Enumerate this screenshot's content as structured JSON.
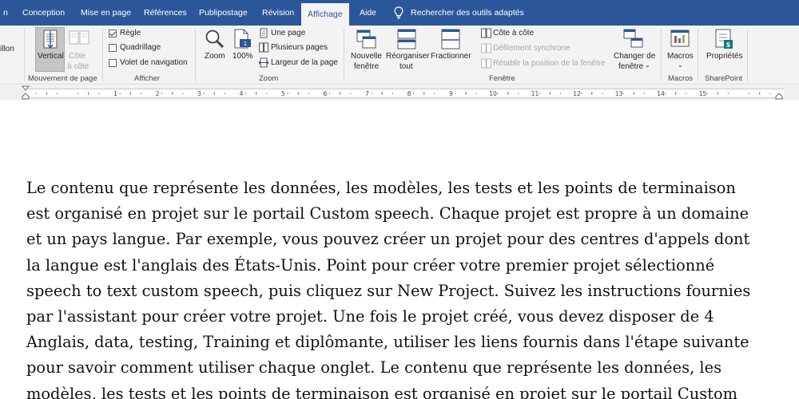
{
  "tabs": [
    {
      "label": "n",
      "active": false
    },
    {
      "label": "Conception",
      "active": false
    },
    {
      "label": "Mise en page",
      "active": false
    },
    {
      "label": "Références",
      "active": false
    },
    {
      "label": "Publipostage",
      "active": false
    },
    {
      "label": "Révision",
      "active": false
    },
    {
      "label": "Affichage",
      "active": true
    },
    {
      "label": "Aide",
      "active": false
    }
  ],
  "search": {
    "label": "Rechercher des outils adaptés"
  },
  "ribbon": {
    "partial_label": "illon",
    "page_movement": {
      "vertical": "Vertical",
      "side_by_side_line1": "Côte",
      "side_by_side_line2": "à côte",
      "group_label": "Mouvement de page"
    },
    "show": {
      "ruler": "Règle",
      "ruler_checked": true,
      "gridlines": "Quadrillage",
      "gridlines_checked": false,
      "nav_pane": "Volet de navigation",
      "nav_pane_checked": false,
      "group_label": "Afficher"
    },
    "zoom": {
      "zoom": "Zoom",
      "hundred": "100%",
      "one_page": "Une page",
      "multiple_pages": "Plusieurs pages",
      "page_width": "Largeur de la page",
      "group_label": "Zoom"
    },
    "window": {
      "new_window_line1": "Nouvelle",
      "new_window_line2": "fenêtre",
      "arrange_line1": "Réorganiser",
      "arrange_line2": "tout",
      "split": "Fractionner",
      "side_by_side": "Côte à côte",
      "sync_scroll": "Défilement synchrone",
      "reset_position": "Rétablir la position de la fenêtre",
      "switch_line1": "Changer de",
      "switch_line2": "fenêtre",
      "group_label": "Fenêtre"
    },
    "macros": {
      "label": "Macros",
      "group_label": "Macros"
    },
    "sharepoint": {
      "label": "Propriétés",
      "group_label": "SharePoint"
    }
  },
  "ruler": {
    "numbers": [
      "2",
      "1",
      "1",
      "2",
      "3",
      "4",
      "5",
      "6",
      "7",
      "8",
      "9",
      "10",
      "11",
      "12",
      "13",
      "14",
      "15"
    ]
  },
  "document": {
    "lines": [
      " Le contenu que représente les données, les modèles, les tests et les points de terminaison",
      "est organisé en projet sur le portail Custom speech. Chaque projet est propre à un domaine",
      "et un pays langue. Par exemple, vous pouvez créer un projet pour des centres d'appels dont",
      "la langue est l'anglais des États-Unis. Point pour créer votre premier projet sélectionné",
      "speech to text custom speech, puis cliquez sur New Project. Suivez les instructions fournies",
      "par l'assistant pour créer votre projet. Une fois le projet créé, vous devez disposer de 4",
      "Anglais, data, testing, Training et diplômante, utiliser les liens fournis dans l'étape suivante",
      "pour savoir comment utiliser chaque onglet.  Le contenu que représente les données, les",
      "modèles, les tests et les points de terminaison est organisé en projet sur le portail Custom"
    ]
  }
}
